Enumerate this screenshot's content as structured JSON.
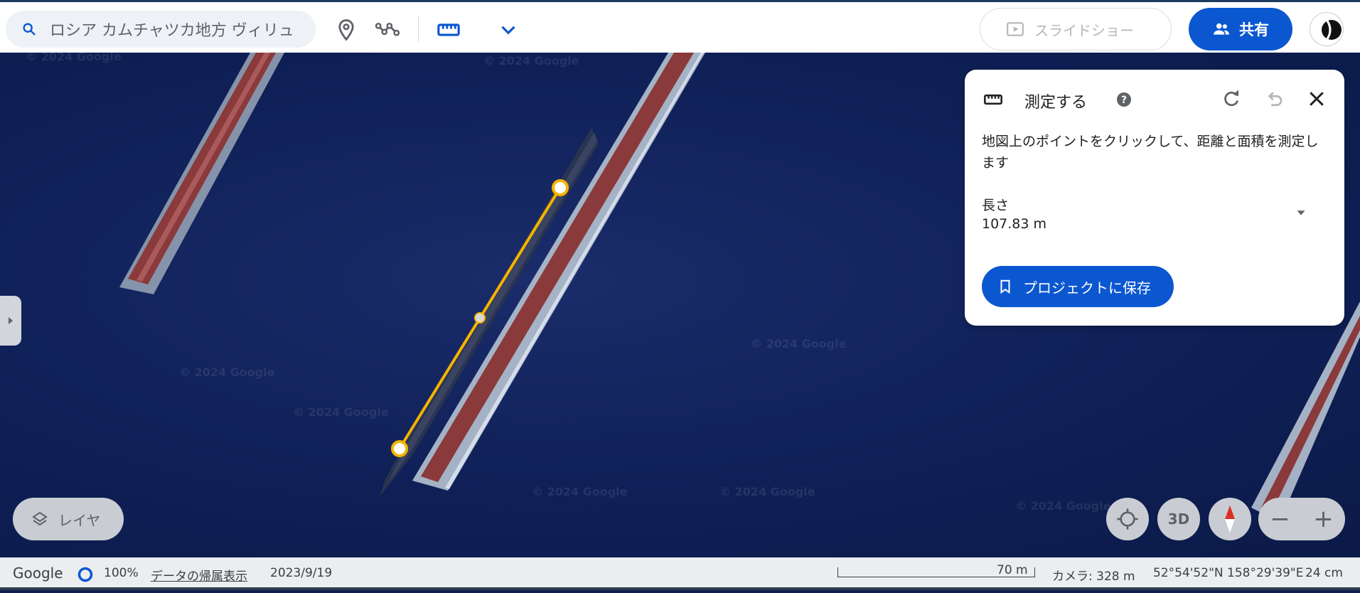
{
  "search": {
    "value": "ロシア カムチャツカ地方 ヴィリュ"
  },
  "toolbar": {
    "icons": [
      "search-icon",
      "place-pin-icon",
      "path-icon",
      "ruler-icon",
      "chevron-down-icon"
    ],
    "slideshow_label": "スライドショー",
    "share_label": "共有"
  },
  "measure_panel": {
    "title": "測定する",
    "description": "地図上のポイントをクリックして、距離と面積を測定します",
    "length_label": "長さ",
    "length_value": "107.83 m",
    "save_label": "プロジェクトに保存"
  },
  "map": {
    "watermark": "© 2024 Google",
    "layer_label": "レイヤ",
    "btn_3d": "3D",
    "zoom_out": "−",
    "zoom_in": "+"
  },
  "status": {
    "logo": "Google",
    "load_percent": "100%",
    "attribution_link": "データの帰属表示",
    "imagery_date": "2023/9/19",
    "scale_label": "70 m",
    "camera": "カメラ: 328 m",
    "coordinates": "52°54'52\"N 158°29'39\"E",
    "eye_alt": "24 cm"
  },
  "colors": {
    "accent": "#0b57d0",
    "measure_line": "#f4b400",
    "water": "#0f2057",
    "pier_deck": "#8a3a3a"
  }
}
